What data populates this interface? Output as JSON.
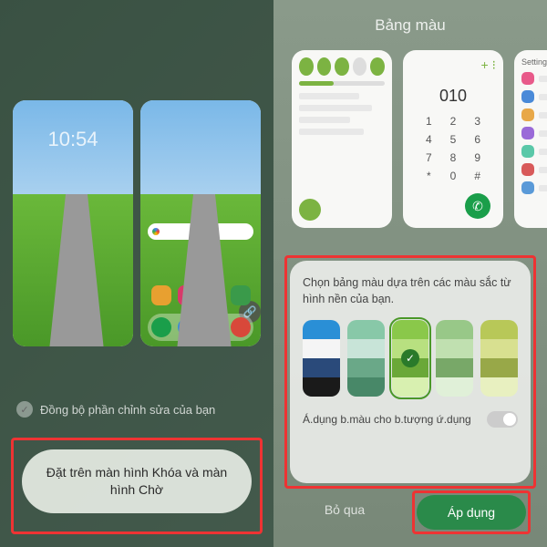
{
  "left": {
    "clock_preview": "10:54",
    "sync_label": "Đồng bộ phần chỉnh sửa của bạn",
    "main_button": "Đặt trên màn hình Khóa và màn hình Chờ"
  },
  "right": {
    "title": "Bảng màu",
    "dialer_number": "010",
    "dial_keys": [
      "1",
      "2",
      "3",
      "4",
      "5",
      "6",
      "7",
      "8",
      "9",
      "*",
      "0",
      "#"
    ],
    "settings_label": "Settings",
    "palette_prompt": "Chọn bảng màu dựa trên các màu sắc từ hình nền của bạn.",
    "swatches": [
      {
        "selected": false,
        "colors": [
          "#2a8fd6",
          "#f5f5f5",
          "#2a4a7a",
          "#1a1a1a"
        ]
      },
      {
        "selected": false,
        "colors": [
          "#88c8a8",
          "#c8e4d8",
          "#6aa888",
          "#488868"
        ]
      },
      {
        "selected": true,
        "colors": [
          "#8ac84a",
          "#b8e080",
          "#6aa838",
          "#d8f0b0"
        ]
      },
      {
        "selected": false,
        "colors": [
          "#98c888",
          "#c0e0b0",
          "#78a868",
          "#e0f0d8"
        ]
      },
      {
        "selected": false,
        "colors": [
          "#b8c858",
          "#d8e090",
          "#98a848",
          "#e8f0c0"
        ]
      }
    ],
    "apply_icons_label": "Á.dụng b.màu cho b.tượng ứ.dụng",
    "apply_icons_on": false,
    "skip_label": "Bỏ qua",
    "apply_label": "Áp dụng"
  }
}
